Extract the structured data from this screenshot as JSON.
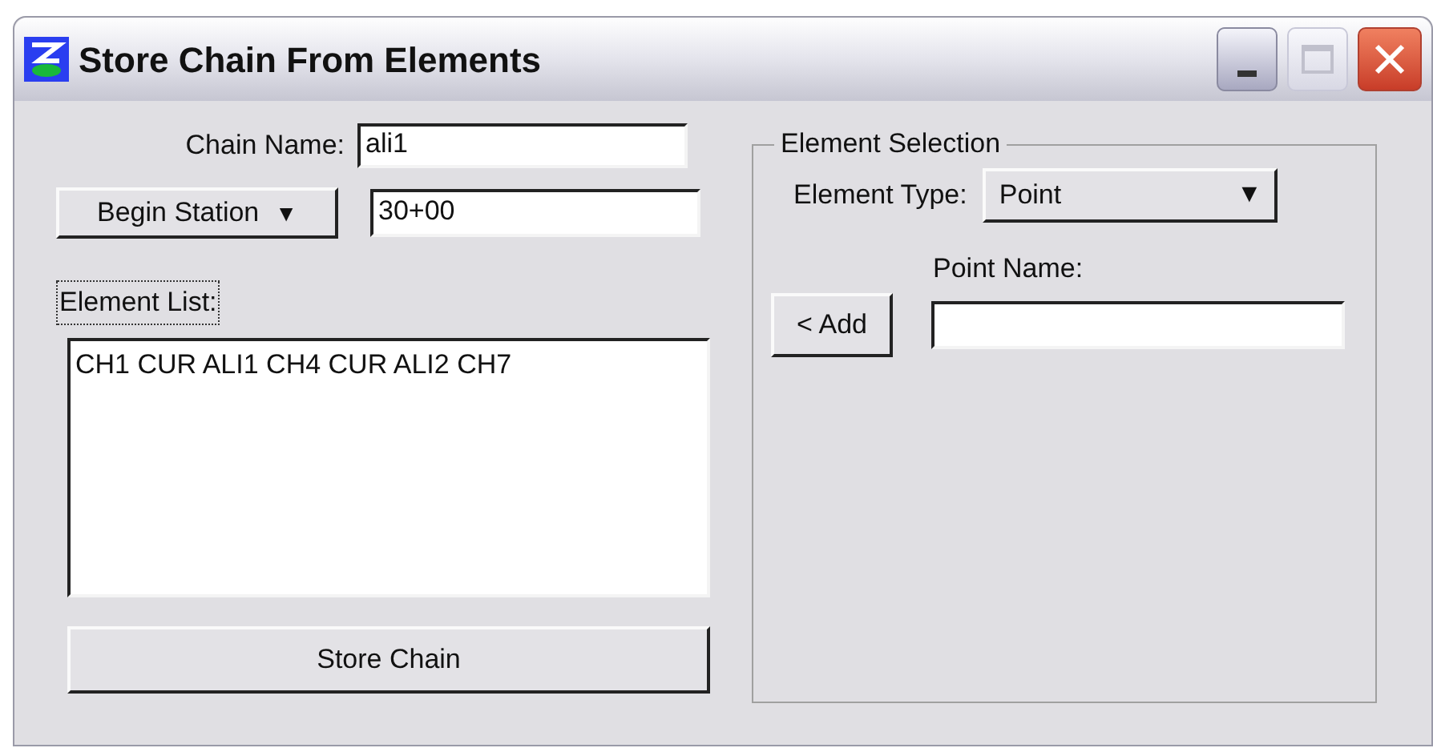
{
  "window": {
    "title": "Store Chain From Elements"
  },
  "chain_name": {
    "label": "Chain Name:",
    "value": "ali1"
  },
  "station": {
    "button": "Begin Station",
    "arrow": "▼",
    "value": "30+00"
  },
  "element_list": {
    "label": "Element List:",
    "focused": true,
    "items": [
      "CH1 CUR ALI1 CH4 CUR ALI2 CH7"
    ]
  },
  "store_button": "Store Chain",
  "element_selection": {
    "title": "Element Selection",
    "type_label": "Element Type:",
    "type_value": "Point",
    "arrow": "▼",
    "add_button": "< Add",
    "name_label": "Point Name:"
  }
}
